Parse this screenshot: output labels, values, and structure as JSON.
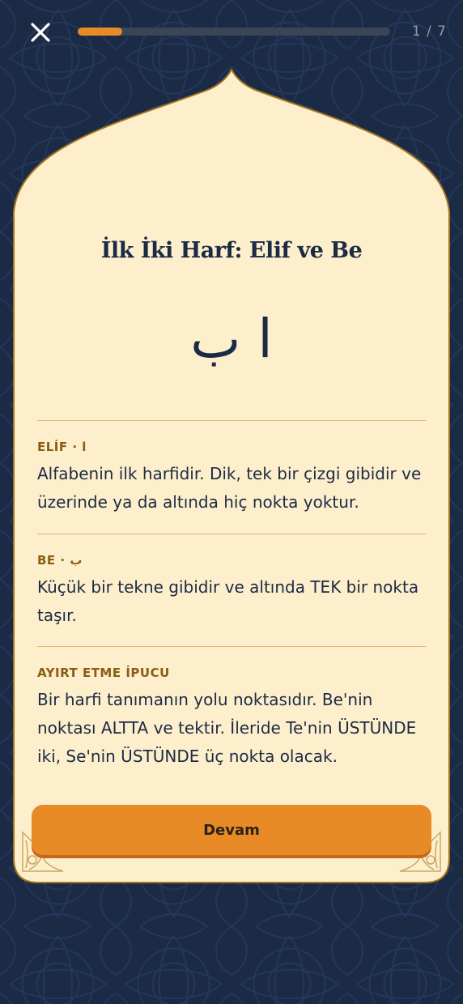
{
  "colors": {
    "background": "#1b2a45",
    "card": "#fdefcb",
    "card_border": "#a4741e",
    "accent": "#e88a25",
    "title_text": "#1b2a45",
    "label_text": "#8a5c14",
    "divider": "#e0b46a"
  },
  "header": {
    "close_icon": "close-icon",
    "progress": {
      "current": 1,
      "total": 7,
      "label": "1 / 7"
    }
  },
  "lesson": {
    "title": "İlk İki Harf: Elif ve Be",
    "letters": "ا ب",
    "sections": [
      {
        "label": "ELİF · ا",
        "text": "Alfabenin ilk harfidir. Dik, tek bir çizgi gibidir ve üzerinde ya da altında hiç nokta yoktur."
      },
      {
        "label": "BE · ب",
        "text": "Küçük bir tekne gibidir ve altında TEK bir nokta taşır."
      },
      {
        "label": "AYIRT ETME İPUCU",
        "text": "Bir harfi tanımanın yolu noktasıdır. Be'nin noktası ALTTA ve tektir. İleride Te'nin ÜSTÜNDE iki, Se'nin ÜSTÜNDE üç nokta olacak."
      }
    ]
  },
  "footer": {
    "continue_label": "Devam"
  }
}
